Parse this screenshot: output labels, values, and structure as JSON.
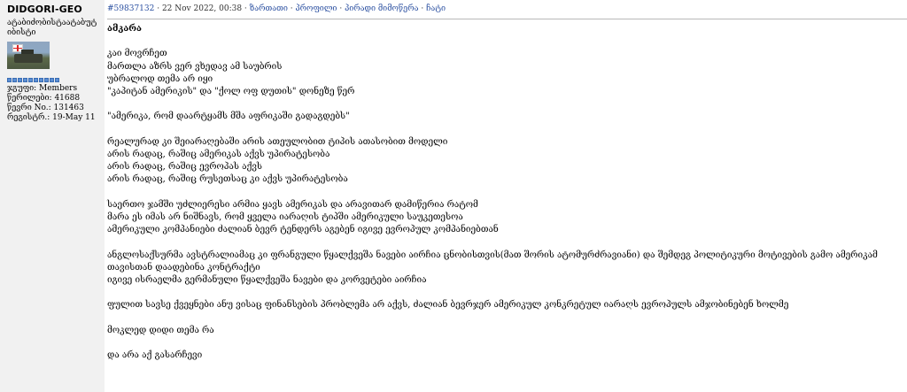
{
  "user": {
    "name": "DIDGORI-GEO",
    "title": "ატაბიძობისტაატაბუტიბისტი",
    "group": "ჯგუფი: Members",
    "posts": "წერილები: 41688",
    "member_no": "წევრი No.: 131463",
    "registered": "რეგისტრ.: 19-May 11"
  },
  "post": {
    "id_link": "#59837132",
    "date": " · 22 Nov 2022, 00:38 · ",
    "actions": [
      "ზართათი",
      "პროფილი",
      "პირადი მიმოწერა",
      "ჩატი"
    ],
    "title": "ამკარა",
    "paragraphs": [
      [
        "კაი მოვრჩეთ",
        "მართლა აზრს ვერ ვხედავ ამ საუბრის",
        "უბრალოდ თემა არ იყი",
        "\"კაპიტან ამერიკის\" და \"ქოლ ოფ დუთის\" დონეზე წერ"
      ],
      [
        "\"ამერიკა, რომ დაარტყამს მშა აფრიკაში გადაგდებს\""
      ],
      [
        "რეალურად კი შეიარაღებაში არის ათეულობით ტიპის ათასობით მოდელი",
        "არის რადაც, რაშიც ამერიკას აქვს უპირატესობა",
        "არის რადაც, რაშიც ევროპას აქვს",
        "არის რადაც, რაშიც რუსეთსაც კი აქვს უპირატესობა"
      ],
      [
        "საერთო ჯამში უძლიერესი არმია ყავს ამერიკას და არავითარ დამიწერია რატომ",
        "მარა ეს იმას არ ნიშნავს, რომ ყველა იარაღის ტიპში ამერიკული საუკეთესოა",
        "ამერიკული კომპანიები ძალიან ბევრ ტენდერს აგებენ იგივე ევროპულ კომპანიებთან"
      ],
      [
        "ანგლოსაქსურმა ავსტრალიამაც კი ფრანგული წყალქვეშა ნავები აირჩია ცნობისთვის(მათ შორის ატომურძრავიანი) და შემდეგ პოლიტიკური მოტივების გამო ამერიკამ თავისთან დაადებინა კონტრაქტი",
        "იგივე ისრაელმა გერმანული წყალქვეშა ნავები და კორვეტები აირჩია"
      ],
      [
        "ფულით სავსე ქვეყნები ანუ ვისაც ფინანსების პრობლემა არ აქვს, ძალიან ბევრჯერ ამერიკულ კონკრეტულ იარაღს ევროპულს ამჯობინებენ ხოლმე"
      ],
      [
        "მოკლედ დიდი თემა რა"
      ],
      [
        "და არა აქ გასარჩევი"
      ]
    ]
  }
}
